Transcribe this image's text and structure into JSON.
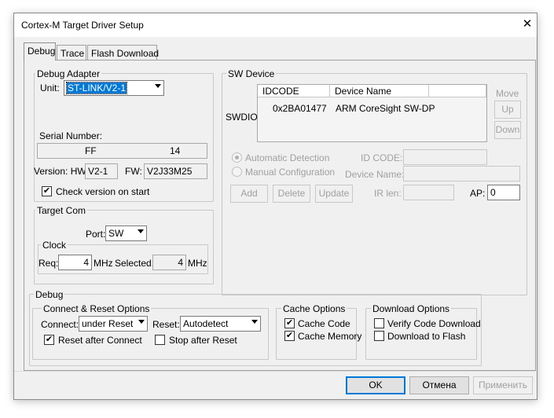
{
  "window": {
    "title": "Cortex-M Target Driver Setup",
    "close_glyph": "✕"
  },
  "tabs": [
    {
      "label": "Debug",
      "active": true
    },
    {
      "label": "Trace",
      "active": false
    },
    {
      "label": "Flash Download",
      "active": false
    }
  ],
  "debug_adapter": {
    "group_label": "Debug Adapter",
    "unit_label": "Unit:",
    "unit_value": "ST-LINK/V2-1",
    "serial_label": "Serial Number:",
    "serial_part1": "FF",
    "serial_part2": "14",
    "version_label": "Version: HW:",
    "hw_value": "V2-1",
    "fw_label": "FW:",
    "fw_value": "V2J33M25",
    "check_version_label": "Check version on start",
    "check_version_checked": true
  },
  "target_com": {
    "group_label": "Target Com",
    "port_label": "Port:",
    "port_value": "SW",
    "clock_label": "Clock",
    "req_label": "Req:",
    "req_value": "4",
    "req_unit": "MHz",
    "selected_label": "Selected:",
    "selected_value": "4",
    "selected_unit": "MHz"
  },
  "sw_device": {
    "group_label": "SW Device",
    "swdio_label": "SWDIO",
    "col_idcode": "IDCODE",
    "col_device": "Device Name",
    "row_idcode": "0x2BA01477",
    "row_device": "ARM CoreSight SW-DP",
    "move_label": "Move",
    "up_label": "Up",
    "down_label": "Down",
    "auto_detect_label": "Automatic Detection",
    "manual_config_label": "Manual Configuration",
    "id_code_label": "ID CODE:",
    "device_name_label": "Device Name:",
    "ir_len_label": "IR len:",
    "ap_label": "AP:",
    "ap_value": "0",
    "add_label": "Add",
    "delete_label": "Delete",
    "update_label": "Update"
  },
  "debug": {
    "group_label": "Debug",
    "connect_reset_label": "Connect & Reset Options",
    "connect_label": "Connect:",
    "connect_value": "under Reset",
    "reset_label": "Reset:",
    "reset_value": "Autodetect",
    "reset_after_connect_label": "Reset after Connect",
    "stop_after_reset_label": "Stop after Reset",
    "cache_options_label": "Cache Options",
    "cache_code_label": "Cache Code",
    "cache_memory_label": "Cache Memory",
    "download_options_label": "Download Options",
    "verify_code_label": "Verify Code Download",
    "download_flash_label": "Download to Flash"
  },
  "footer": {
    "ok_label": "OK",
    "cancel_label": "Отмена",
    "apply_label": "Применить"
  }
}
